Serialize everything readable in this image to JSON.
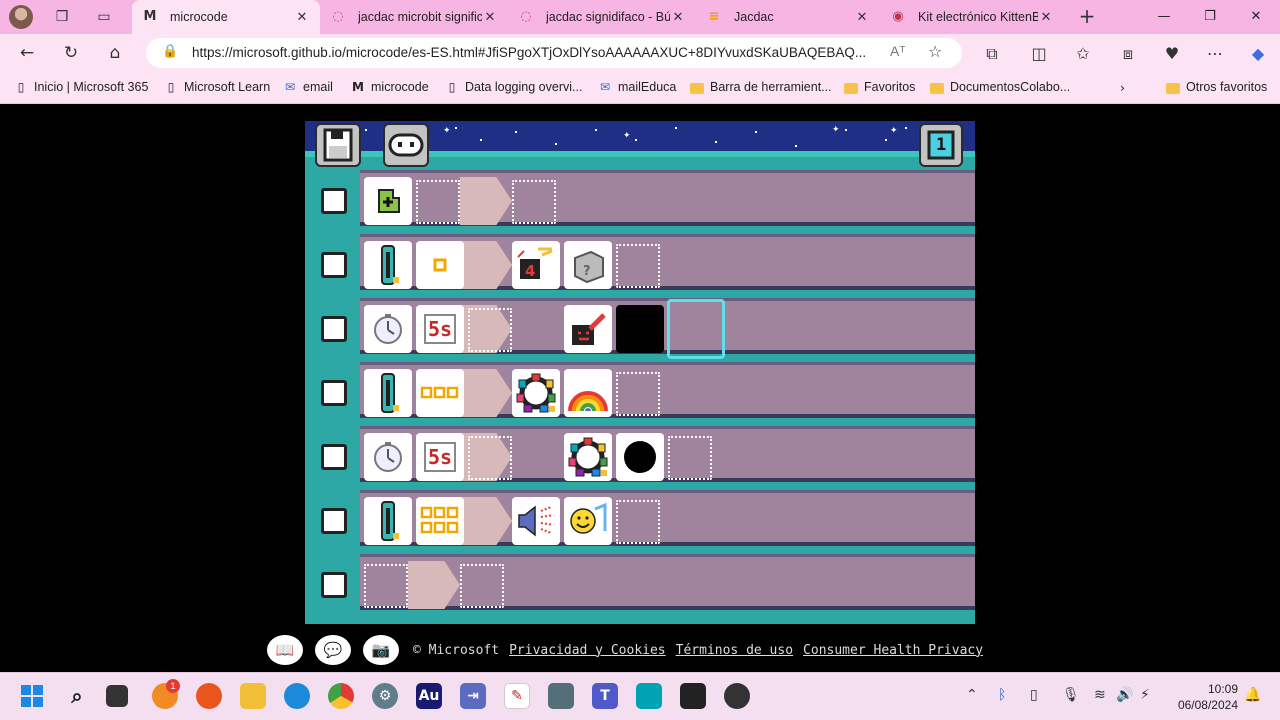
{
  "browser": {
    "tabs": [
      {
        "label": "microcode",
        "favicon": "M",
        "active": true
      },
      {
        "label": "jacdac microbit signific",
        "favicon": "◌",
        "active": false
      },
      {
        "label": "jacdac signidifaco - Bú",
        "favicon": "◌",
        "active": false
      },
      {
        "label": "Jacdac",
        "favicon": "≡",
        "active": false
      },
      {
        "label": "Kit electrónico KittenB",
        "favicon": "◉",
        "active": false
      }
    ],
    "url": "https://microsoft.github.io/microcode/es-ES.html#JfiSPgoXTjOxDlYsoAAAAAAXUC+8DIYvuxdSKaUBAQEBAQ...",
    "read_aloud": "Aᵀ",
    "bookmarks": [
      {
        "label": "Inicio | Microsoft 365",
        "icon": "doc-icon"
      },
      {
        "label": "Microsoft Learn",
        "icon": "doc-icon"
      },
      {
        "label": "email",
        "icon": "mail-icon"
      },
      {
        "label": "microcode",
        "icon": "microcode-icon"
      },
      {
        "label": "Data logging overvi...",
        "icon": "doc-icon"
      },
      {
        "label": "mailEduca",
        "icon": "mail-icon"
      },
      {
        "label": "Barra de herramient...",
        "icon": "folder-icon"
      },
      {
        "label": "Favoritos",
        "icon": "folder-icon"
      },
      {
        "label": "DocumentosColabo...",
        "icon": "folder-icon"
      }
    ],
    "other_favorites": "Otros favoritos"
  },
  "editor": {
    "page_number": "1",
    "rules": [
      {
        "when": [
          "button-a"
        ],
        "do": []
      },
      {
        "when": [
          "rotary-encoder",
          "dot-1"
        ],
        "do": [
          "random",
          "dice"
        ]
      },
      {
        "when": [
          "timer",
          "5s"
        ],
        "do": [
          "paint",
          "black"
        ]
      },
      {
        "when": [
          "rotary-encoder",
          "dots-3"
        ],
        "do": [
          "led-ring",
          "rainbow"
        ]
      },
      {
        "when": [
          "timer",
          "5s"
        ],
        "do": [
          "led-ring",
          "black-dot"
        ]
      },
      {
        "when": [
          "rotary-encoder",
          "dots-6"
        ],
        "do": [
          "speaker",
          "happy"
        ]
      },
      {
        "when": [],
        "do": []
      }
    ],
    "timer_label": "5s"
  },
  "footer": {
    "copyright": "© Microsoft",
    "links": [
      "Privacidad y Cookies",
      "Términos de uso",
      "Consumer Health Privacy"
    ]
  },
  "taskbar": {
    "time": "10:09",
    "date": "06/08/2024",
    "badge": "1"
  }
}
